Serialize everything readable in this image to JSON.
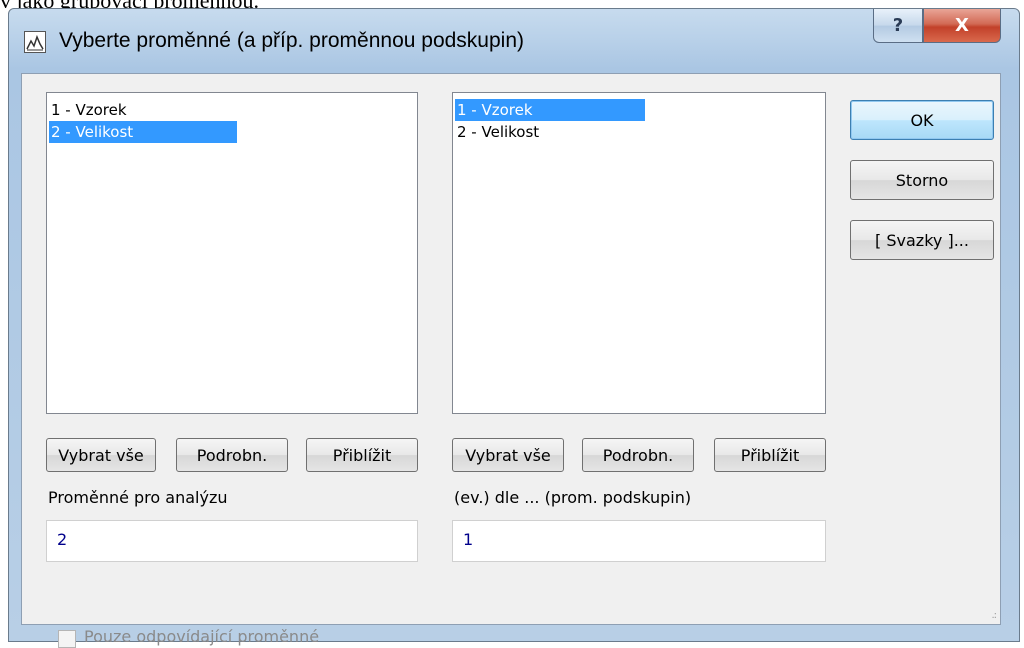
{
  "background_text": "v jako grupovací proměnnou.",
  "window": {
    "title": "Vyberte proměnné (a příp. proměnnou podskupin)",
    "help_label": "?",
    "close_label": "X"
  },
  "left_panel": {
    "items": [
      {
        "label": "1 - Vzorek",
        "selected": false
      },
      {
        "label": "2 - Velikost",
        "selected": true
      }
    ],
    "buttons": {
      "select_all": "Vybrat vše",
      "details": "Podrobn.",
      "zoom": "Přiblížit"
    },
    "label": "Proměnné pro analýzu",
    "value": "2"
  },
  "right_panel": {
    "items": [
      {
        "label": "1 - Vzorek",
        "selected": true
      },
      {
        "label": "2 - Velikost",
        "selected": false
      }
    ],
    "buttons": {
      "select_all": "Vybrat vše",
      "details": "Podrobn.",
      "zoom": "Přiblížit"
    },
    "label": "(ev.) dle ... (prom. podskupin)",
    "value": "1"
  },
  "actions": {
    "ok": "OK",
    "cancel": "Storno",
    "bundles": "[ Svazky ]..."
  },
  "checkbox": {
    "label": "Pouze odpovídající proměnné",
    "checked": false,
    "enabled": false
  },
  "icons": {
    "app": "chart-app-icon",
    "help": "help-icon",
    "close": "close-icon",
    "grip": "resize-grip-icon"
  },
  "colors": {
    "selection": "#3399ff",
    "field_value": "#00008b",
    "close_button": "#c2412a"
  }
}
